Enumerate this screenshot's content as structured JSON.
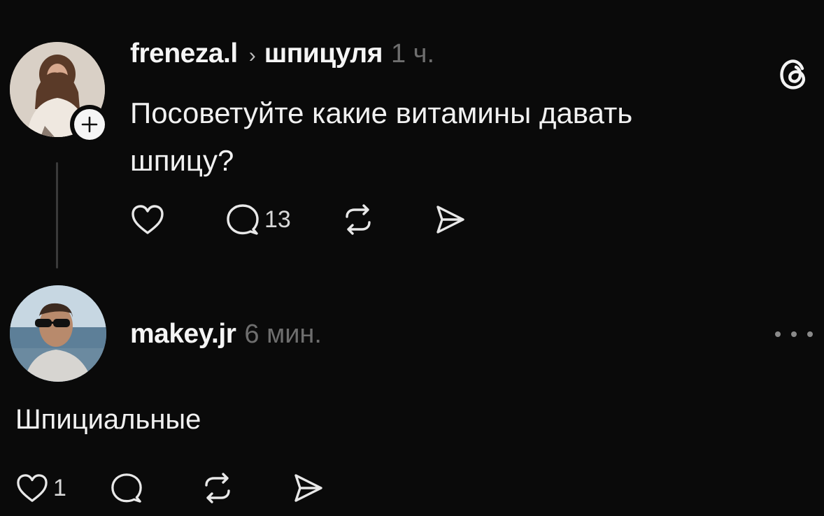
{
  "post": {
    "author": "freneza.l",
    "topic": "шпицуля",
    "time": "1 ч.",
    "text_line1": "Посоветуйте какие витамины давать",
    "text_line2": "шпицу?",
    "replies_count": "13"
  },
  "reply": {
    "author": "makey.jr",
    "time": "6 мин.",
    "text": "Шпициальные",
    "likes_count": "1"
  },
  "icons": {
    "like": "heart-icon",
    "comment": "comment-icon",
    "repost": "repost-icon",
    "share": "send-icon",
    "app": "threads-logo-icon",
    "more": "more-dots-icon",
    "follow": "plus-icon"
  }
}
